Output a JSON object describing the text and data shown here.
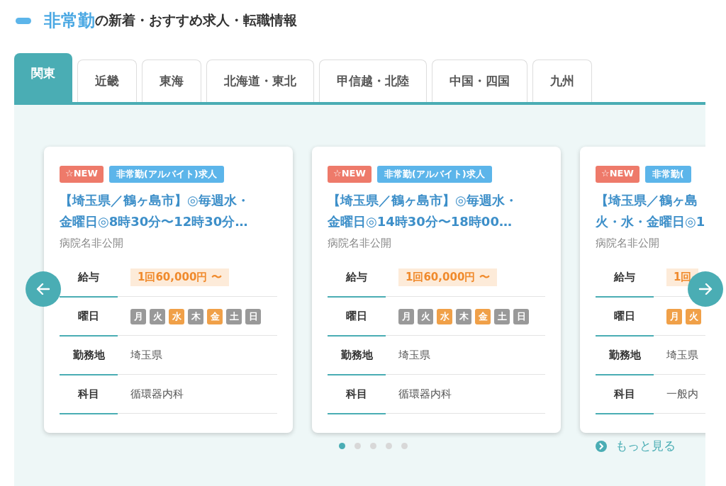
{
  "heading": {
    "highlight": "非常勤",
    "rest": "の新着・おすすめ求人・転職情報"
  },
  "tabs": [
    {
      "label": "関東",
      "selected": true
    },
    {
      "label": "近畿",
      "selected": false
    },
    {
      "label": "東海",
      "selected": false
    },
    {
      "label": "北海道・東北",
      "selected": false
    },
    {
      "label": "甲信越・北陸",
      "selected": false
    },
    {
      "label": "中国・四国",
      "selected": false
    },
    {
      "label": "九州",
      "selected": false
    }
  ],
  "cards": [
    {
      "new_badge": "☆NEW",
      "type_badge": "非常勤(アルバイト)求人",
      "title_lines": [
        "【埼玉県／鶴ヶ島市】◎毎週水・",
        "金曜日◎8時30分〜12時30分…"
      ],
      "hospital": "病院名非公開",
      "rows": [
        {
          "kind": "salary",
          "label": "給与",
          "value": "1回60,000円 〜"
        },
        {
          "kind": "days",
          "label": "曜日",
          "days": [
            {
              "label": "月",
              "on": false
            },
            {
              "label": "火",
              "on": false
            },
            {
              "label": "水",
              "on": true
            },
            {
              "label": "木",
              "on": false
            },
            {
              "label": "金",
              "on": true
            },
            {
              "label": "土",
              "on": false
            },
            {
              "label": "日",
              "on": false
            }
          ]
        },
        {
          "kind": "text",
          "label": "勤務地",
          "value": "埼玉県"
        },
        {
          "kind": "text",
          "label": "科目",
          "value": "循環器内科"
        }
      ]
    },
    {
      "new_badge": "☆NEW",
      "type_badge": "非常勤(アルバイト)求人",
      "title_lines": [
        "【埼玉県／鶴ヶ島市】◎毎週水・",
        "金曜日◎14時30分〜18時00…"
      ],
      "hospital": "病院名非公開",
      "rows": [
        {
          "kind": "salary",
          "label": "給与",
          "value": "1回60,000円 〜"
        },
        {
          "kind": "days",
          "label": "曜日",
          "days": [
            {
              "label": "月",
              "on": false
            },
            {
              "label": "火",
              "on": false
            },
            {
              "label": "水",
              "on": true
            },
            {
              "label": "木",
              "on": false
            },
            {
              "label": "金",
              "on": true
            },
            {
              "label": "土",
              "on": false
            },
            {
              "label": "日",
              "on": false
            }
          ]
        },
        {
          "kind": "text",
          "label": "勤務地",
          "value": "埼玉県"
        },
        {
          "kind": "text",
          "label": "科目",
          "value": "循環器内科"
        }
      ]
    },
    {
      "new_badge": "☆NEW",
      "type_badge": "非常勤(",
      "title_lines": [
        "【埼玉県／鶴ヶ島",
        "火・水・金曜日◎1"
      ],
      "hospital": "病院名非公開",
      "rows": [
        {
          "kind": "salary",
          "label": "給与",
          "value": "1回"
        },
        {
          "kind": "days",
          "label": "曜日",
          "days": [
            {
              "label": "月",
              "on": true
            },
            {
              "label": "火",
              "on": true
            }
          ]
        },
        {
          "kind": "text",
          "label": "勤務地",
          "value": "埼玉県"
        },
        {
          "kind": "text",
          "label": "科目",
          "value": "一般内"
        }
      ]
    }
  ],
  "pager": [
    {
      "selected": true
    },
    {
      "selected": false
    },
    {
      "selected": false
    },
    {
      "selected": false
    },
    {
      "selected": false
    }
  ],
  "more_link": "もっと見る"
}
